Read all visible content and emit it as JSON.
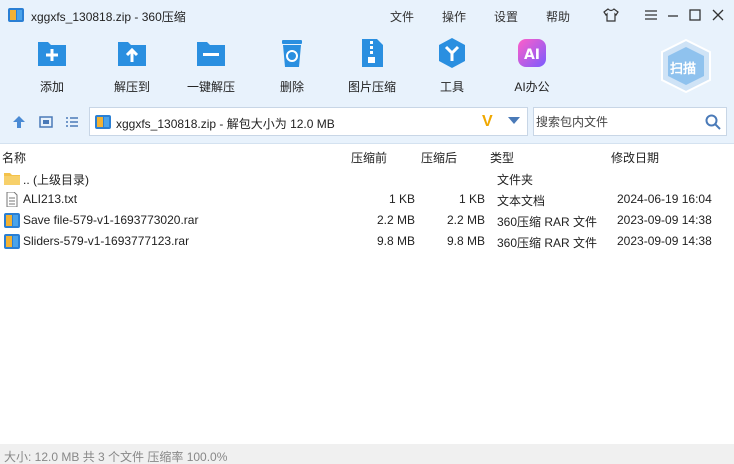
{
  "window": {
    "title": "xggxfs_130818.zip - 360压缩",
    "menu": [
      "文件",
      "操作",
      "设置",
      "帮助"
    ]
  },
  "toolbar": {
    "items": [
      {
        "label": "添加",
        "icon": "add-icon"
      },
      {
        "label": "解压到",
        "icon": "extract-to-icon"
      },
      {
        "label": "一键解压",
        "icon": "one-click-extract-icon"
      },
      {
        "label": "删除",
        "icon": "delete-icon"
      },
      {
        "label": "图片压缩",
        "icon": "image-compress-icon"
      },
      {
        "label": "工具",
        "icon": "tools-icon"
      },
      {
        "label": "AI办公",
        "icon": "ai-office-icon"
      }
    ],
    "scan_label": "扫描"
  },
  "address": {
    "path": "xggxfs_130818.zip - 解包大小为 12.0 MB"
  },
  "search": {
    "placeholder": "搜索包内文件"
  },
  "columns": {
    "name": "名称",
    "compressed": "压缩前",
    "original": "压缩后",
    "type": "类型",
    "modified": "修改日期"
  },
  "files": [
    {
      "name": ".. (上级目录)",
      "before": "",
      "after": "",
      "type": "文件夹",
      "date": "",
      "icon": "folder-icon"
    },
    {
      "name": "ALI213.txt",
      "before": "1 KB",
      "after": "1 KB",
      "type": "文本文档",
      "date": "2024-06-19 16:04",
      "icon": "text-file-icon"
    },
    {
      "name": "Save file-579-v1-1693773020.rar",
      "before": "2.2 MB",
      "after": "2.2 MB",
      "type": "360压缩 RAR 文件",
      "date": "2023-09-09 14:38",
      "icon": "rar-file-icon"
    },
    {
      "name": "Sliders-579-v1-1693777123.rar",
      "before": "9.8 MB",
      "after": "9.8 MB",
      "type": "360压缩 RAR 文件",
      "date": "2023-09-09 14:38",
      "icon": "rar-file-icon"
    }
  ],
  "status": {
    "text": "大小: 12.0 MB 共 3 个文件 压缩率 100.0%"
  },
  "colors": {
    "accent": "#2a8fe0",
    "toolbar_bg": "#e8f2fc"
  }
}
